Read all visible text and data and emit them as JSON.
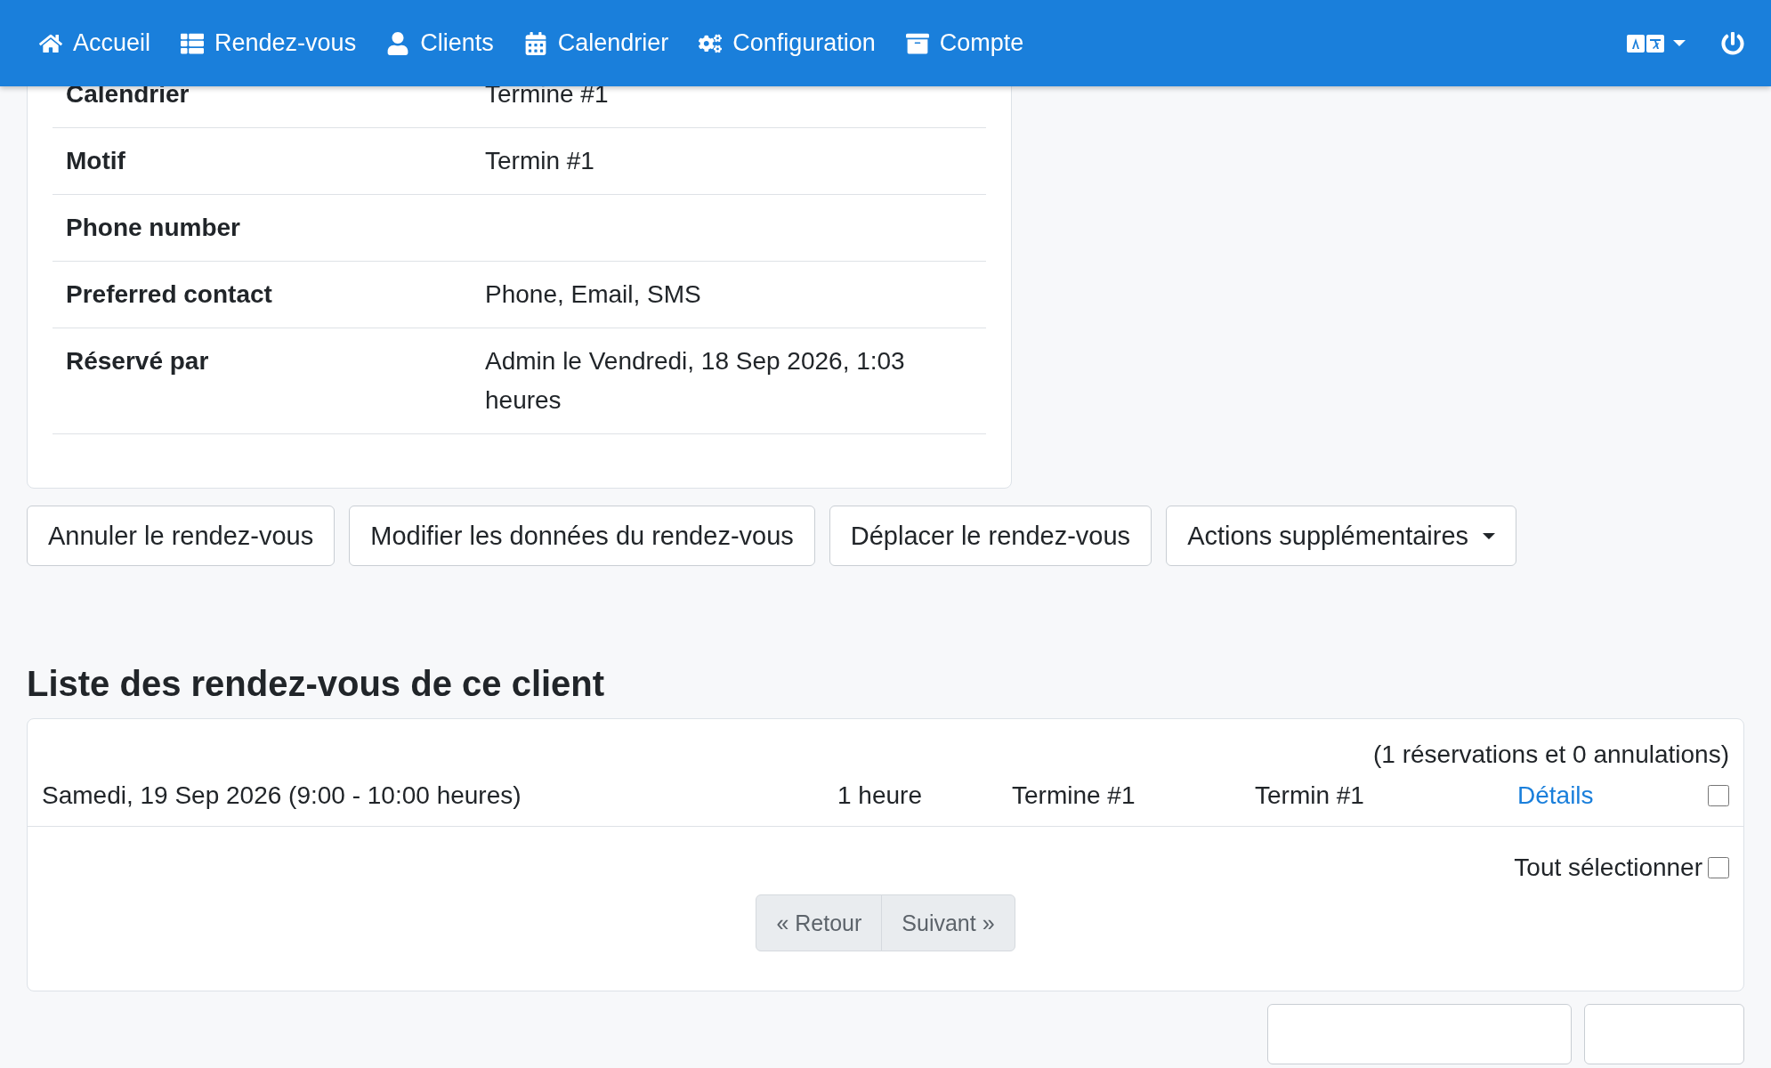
{
  "navbar": {
    "items": [
      {
        "label": "Accueil"
      },
      {
        "label": "Rendez-vous"
      },
      {
        "label": "Clients"
      },
      {
        "label": "Calendrier"
      },
      {
        "label": "Configuration"
      },
      {
        "label": "Compte"
      }
    ]
  },
  "details": {
    "rows": [
      {
        "label": "Calendrier",
        "value": "Termine #1"
      },
      {
        "label": "Motif",
        "value": "Termin #1"
      },
      {
        "label": "Phone number"
      },
      {
        "label": "Preferred contact",
        "value": "Phone, Email, SMS"
      },
      {
        "label": "Réservé par",
        "value": "Admin le Vendredi, 18 Sep 2026, 1:03 heures"
      }
    ]
  },
  "actions": [
    {
      "label": "Annuler le rendez-vous",
      "kind": "button"
    },
    {
      "label": "Modifier les données du rendez-vous",
      "kind": "button"
    },
    {
      "label": "Déplacer le rendez-vous",
      "kind": "button"
    },
    {
      "label": "Actions supplémentaires",
      "kind": "dropdown"
    }
  ],
  "appointment_list": {
    "title": "Liste des rendez-vous de ce client",
    "summary": "(1 réservations et 0 annulations)",
    "rows": [
      {
        "date": "Samedi, 19 Sep 2026 (9:00 - 10:00 heures)",
        "duration": "1 heure",
        "calendar": "Termine #1",
        "reason": "Termin #1",
        "link": "Détails",
        "checked": false
      }
    ],
    "select_all": {
      "label": "Tout sélectionner",
      "checked": false
    },
    "pagination": [
      "« Retour",
      "Suivant »"
    ]
  }
}
